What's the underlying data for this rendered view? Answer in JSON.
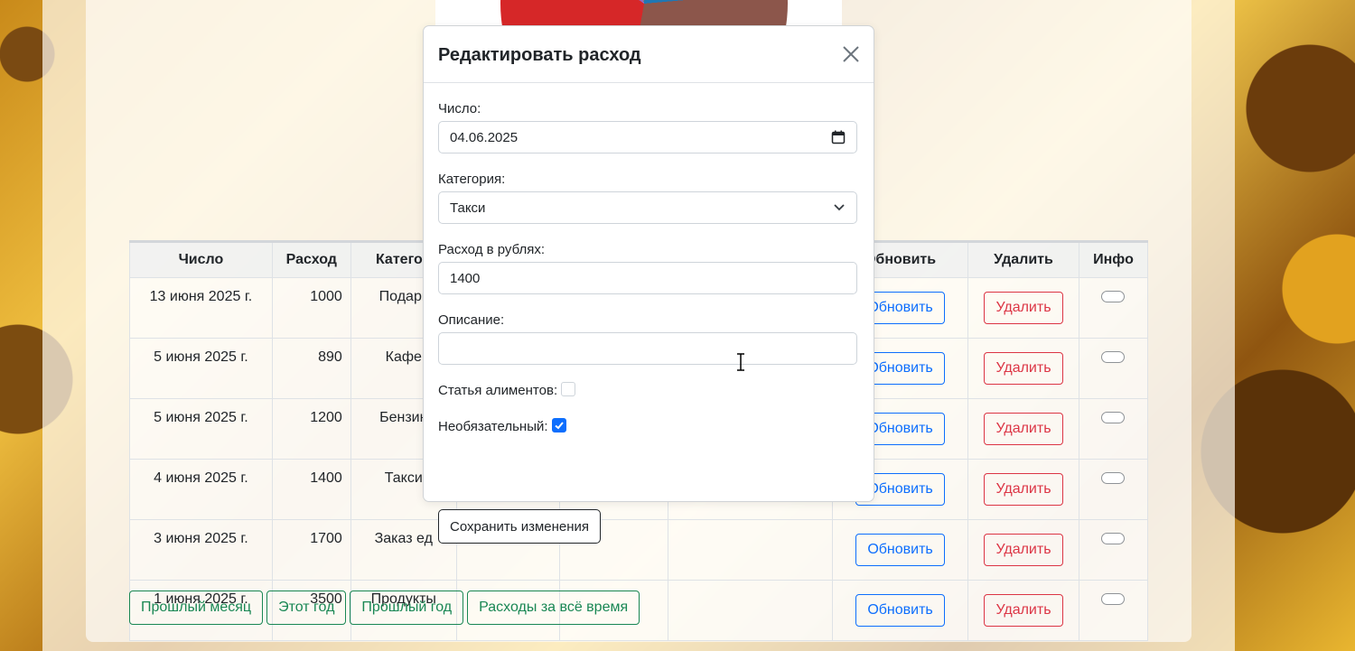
{
  "table": {
    "headers": [
      "Число",
      "Расход",
      "Категор",
      "",
      "",
      "",
      "Обновить",
      "Удалить",
      "Инфо"
    ],
    "rows": [
      {
        "date": "13 июня 2025 г.",
        "amount": "1000",
        "category": "Подарк"
      },
      {
        "date": "5 июня 2025 г.",
        "amount": "890",
        "category": "Кафе"
      },
      {
        "date": "5 июня 2025 г.",
        "amount": "1200",
        "category": "Бензин"
      },
      {
        "date": "4 июня 2025 г.",
        "amount": "1400",
        "category": "Такси"
      },
      {
        "date": "3 июня 2025 г.",
        "amount": "1700",
        "category": "Заказ ед"
      },
      {
        "date": "1 июня 2025 г.",
        "amount": "3500",
        "category": "Продукты"
      }
    ],
    "update_label": "Обновить",
    "delete_label": "Удалить"
  },
  "bottom_buttons": [
    "Прошлый месяц",
    "Этот год",
    "Прошлый год",
    "Расходы за всё время"
  ],
  "modal": {
    "title": "Редактировать расход",
    "date_label": "Число:",
    "date_value": "04.06.2025",
    "category_label": "Категория:",
    "category_value": "Такси",
    "amount_label": "Расход в рублях:",
    "amount_value": "1400",
    "description_label": "Описание:",
    "description_value": "",
    "alimony_label": "Статья алиментов:",
    "alimony_checked": false,
    "optional_label": "Необязательный:",
    "optional_checked": true,
    "save_label": "Сохранить изменения"
  },
  "colors": {
    "primary": "#0d6efd",
    "danger": "#dc3545",
    "success": "#198754",
    "pie": [
      "#1f77b4",
      "#8c564b",
      "#d62728",
      "#9467bd",
      "#2ca02c",
      "#ff7f0e"
    ]
  }
}
